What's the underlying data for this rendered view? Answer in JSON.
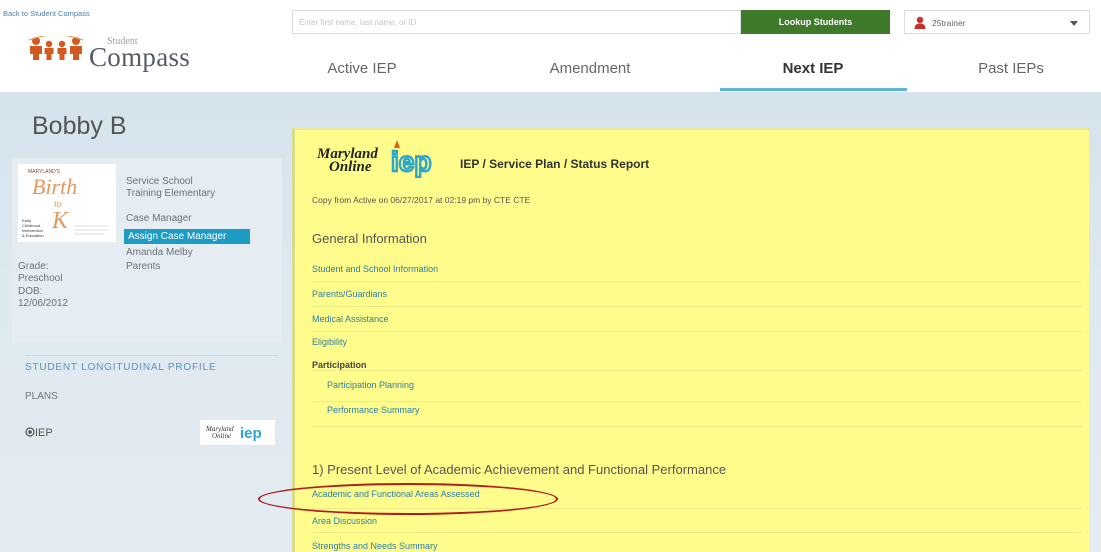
{
  "header": {
    "back_link": "Back to Student Compass",
    "brand_small": "Student",
    "brand_big": "Compass",
    "search_placeholder": "Enter first name, last name, or ID",
    "lookup_label": "Lookup Students",
    "user_name": "25trainer",
    "tabs": [
      "Active IEP",
      "Amendment",
      "Next IEP",
      "Past IEPs"
    ],
    "active_tab": "Next IEP"
  },
  "student": {
    "name": "Bobby B",
    "service_school_label": "Service School",
    "service_school_value": "Training Elementary",
    "case_manager_label": "Case Manager",
    "assign_label": "Assign Case Manager",
    "case_manager_name": "Amanda Melby",
    "parents_label": "Parents",
    "grade_label": "Grade:",
    "grade_value": "Preschool",
    "dob_label": "DOB:",
    "dob_value": "12/06/2012",
    "profile_title": "STUDENT LONGITUDINAL PROFILE",
    "plans_label": "PLANS",
    "iep_label": "IEP",
    "bk_logo_text": "Birth to K"
  },
  "document": {
    "logo_line1": "Maryland",
    "logo_line2": "Online",
    "logo_word": "iep",
    "title": "IEP / Service Plan / Status Report",
    "copy_line": "Copy from Active on 06/27/2017 at 02:19 pm by CTE CTE",
    "section1": "General Information",
    "rows": [
      {
        "label": "Student and School Information",
        "type": "link"
      },
      {
        "label": "Parents/Guardians",
        "type": "link"
      },
      {
        "label": "Medical Assistance",
        "type": "link"
      },
      {
        "label": "Eligibility",
        "type": "link"
      },
      {
        "label": "Participation",
        "type": "bold"
      },
      {
        "label": "Participation Planning",
        "type": "sublink"
      },
      {
        "label": "Performance Summary",
        "type": "sublink"
      }
    ],
    "section2": "1) Present Level of Academic Achievement and Functional Performance",
    "rows2": [
      {
        "label": "Academic and Functional Areas Assessed"
      },
      {
        "label": "Area Discussion"
      },
      {
        "label": "Strengths and Needs Summary"
      }
    ]
  },
  "colors": {
    "lookup": "#3f7a2a",
    "assign": "#1d9cc4",
    "doc_bg": "#fefd8c",
    "tab_underline": "#5fb6d3",
    "annotation": "#b01d1d"
  }
}
